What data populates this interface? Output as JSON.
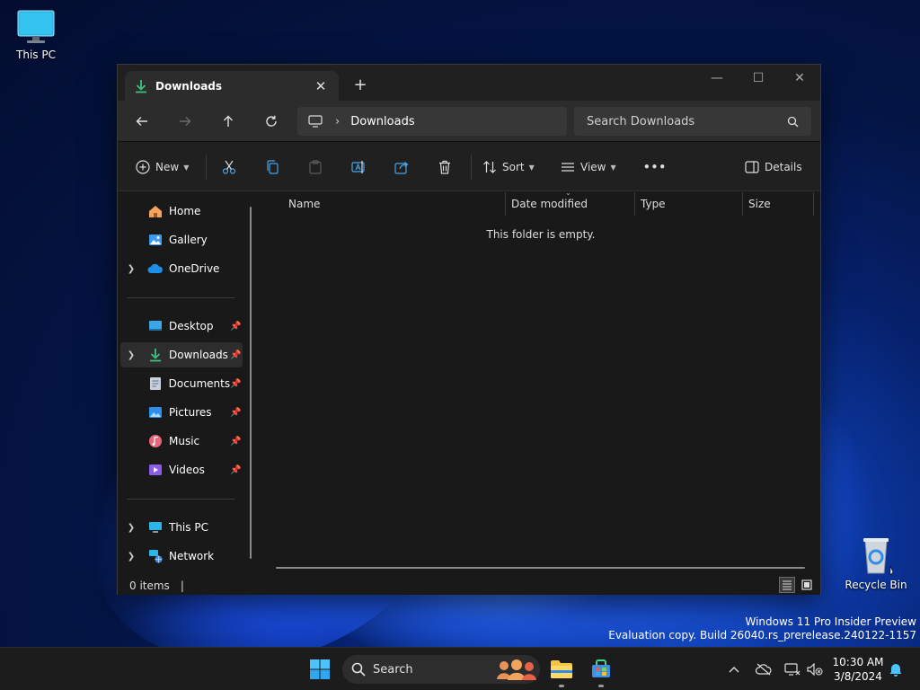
{
  "desktop": {
    "icons": [
      {
        "label": "This PC"
      },
      {
        "label": "Recycle Bin"
      }
    ],
    "watermark": {
      "line1": "Windows 11 Pro Insider Preview",
      "line2": "Evaluation copy. Build 26040.rs_prerelease.240122-1157"
    }
  },
  "window": {
    "tab": {
      "title": "Downloads",
      "close": "✕"
    },
    "new_tab": "+",
    "controls": {
      "minimize": "—",
      "maximize": "☐",
      "close": "✕"
    },
    "address": {
      "crumb": "Downloads",
      "separator": "›"
    },
    "search": {
      "placeholder": "Search Downloads"
    },
    "toolbar": {
      "new_label": "New",
      "sort_label": "Sort",
      "view_label": "View",
      "more_label": "•••",
      "details_label": "Details"
    },
    "sidebar": {
      "items": [
        {
          "label": "Home",
          "icon": "home-icon"
        },
        {
          "label": "Gallery",
          "icon": "gallery-icon"
        },
        {
          "label": "OneDrive",
          "icon": "onedrive-icon"
        },
        {
          "label": "Desktop",
          "icon": "desktop-folder-icon"
        },
        {
          "label": "Downloads",
          "icon": "downloads-folder-icon"
        },
        {
          "label": "Documents",
          "icon": "documents-folder-icon"
        },
        {
          "label": "Pictures",
          "icon": "pictures-folder-icon"
        },
        {
          "label": "Music",
          "icon": "music-folder-icon"
        },
        {
          "label": "Videos",
          "icon": "videos-folder-icon"
        },
        {
          "label": "This PC",
          "icon": "this-pc-icon"
        },
        {
          "label": "Network",
          "icon": "network-icon"
        }
      ]
    },
    "columns": [
      "Name",
      "Date modified",
      "Type",
      "Size"
    ],
    "empty_message": "This folder is empty.",
    "status": {
      "items": "0 items"
    }
  },
  "taskbar": {
    "search_label": "Search",
    "clock": {
      "time": "10:30 AM",
      "date": "3/8/2024"
    }
  },
  "colors": {
    "accent": "#0078d4",
    "window_bg": "#191919",
    "taskbar_bg": "#1c1c1c"
  }
}
